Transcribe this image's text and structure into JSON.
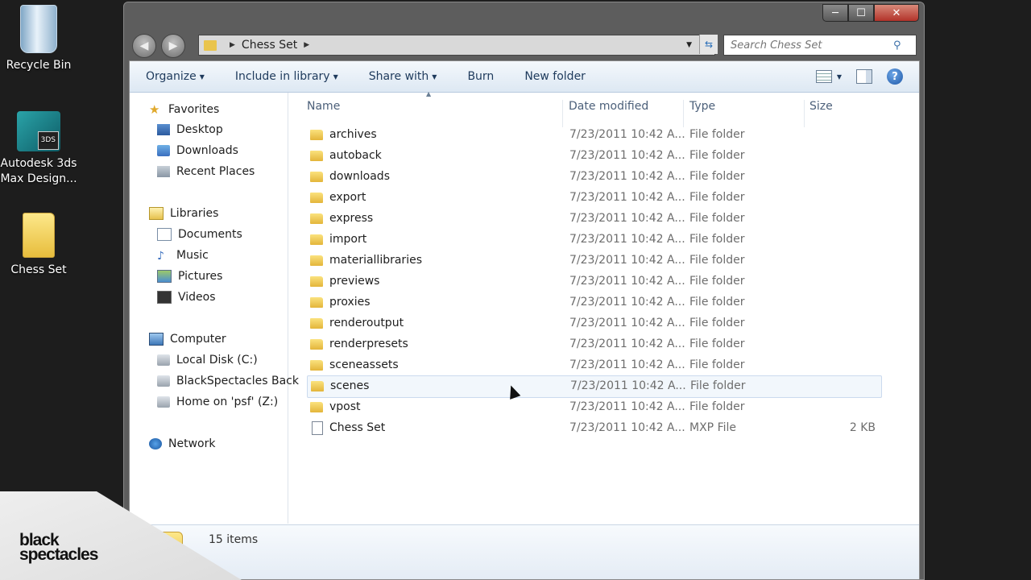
{
  "desktop": {
    "icons": [
      {
        "label_line1": "Recycle Bin",
        "label_line2": "",
        "icon": "recycle-bin-icon"
      },
      {
        "label_line1": "Autodesk 3ds",
        "label_line2": "Max Design...",
        "icon": "autodesk-3ds-max-icon",
        "badge": "3DS"
      },
      {
        "label_line1": "Chess Set",
        "label_line2": "",
        "icon": "folder-icon"
      }
    ]
  },
  "window": {
    "caption": {
      "minimize": "─",
      "maximize": "☐",
      "close": "✕"
    },
    "address": {
      "segment": "Chess Set"
    },
    "search": {
      "placeholder": "Search Chess Set"
    }
  },
  "toolbar": {
    "organize": "Organize",
    "include_in_library": "Include in library",
    "share_with": "Share with",
    "burn": "Burn",
    "new_folder": "New folder"
  },
  "nav": {
    "favorites": "Favorites",
    "desktop": "Desktop",
    "downloads": "Downloads",
    "recent_places": "Recent Places",
    "libraries": "Libraries",
    "documents": "Documents",
    "music": "Music",
    "pictures": "Pictures",
    "videos": "Videos",
    "computer": "Computer",
    "local_disk": "Local Disk (C:)",
    "blackspectacles": "BlackSpectacles Back",
    "home_psf": "Home on 'psf' (Z:)",
    "network": "Network"
  },
  "columns": {
    "name": "Name",
    "date": "Date modified",
    "type": "Type",
    "size": "Size"
  },
  "files": [
    {
      "name": "archives",
      "date": "7/23/2011 10:42 A...",
      "type": "File folder",
      "size": ""
    },
    {
      "name": "autoback",
      "date": "7/23/2011 10:42 A...",
      "type": "File folder",
      "size": ""
    },
    {
      "name": "downloads",
      "date": "7/23/2011 10:42 A...",
      "type": "File folder",
      "size": ""
    },
    {
      "name": "export",
      "date": "7/23/2011 10:42 A...",
      "type": "File folder",
      "size": ""
    },
    {
      "name": "express",
      "date": "7/23/2011 10:42 A...",
      "type": "File folder",
      "size": ""
    },
    {
      "name": "import",
      "date": "7/23/2011 10:42 A...",
      "type": "File folder",
      "size": ""
    },
    {
      "name": "materiallibraries",
      "date": "7/23/2011 10:42 A...",
      "type": "File folder",
      "size": ""
    },
    {
      "name": "previews",
      "date": "7/23/2011 10:42 A...",
      "type": "File folder",
      "size": ""
    },
    {
      "name": "proxies",
      "date": "7/23/2011 10:42 A...",
      "type": "File folder",
      "size": ""
    },
    {
      "name": "renderoutput",
      "date": "7/23/2011 10:42 A...",
      "type": "File folder",
      "size": ""
    },
    {
      "name": "renderpresets",
      "date": "7/23/2011 10:42 A...",
      "type": "File folder",
      "size": ""
    },
    {
      "name": "sceneassets",
      "date": "7/23/2011 10:42 A...",
      "type": "File folder",
      "size": ""
    },
    {
      "name": "scenes",
      "date": "7/23/2011 10:42 A...",
      "type": "File folder",
      "size": ""
    },
    {
      "name": "vpost",
      "date": "7/23/2011 10:42 A...",
      "type": "File folder",
      "size": ""
    },
    {
      "name": "Chess Set",
      "date": "7/23/2011 10:42 A...",
      "type": "MXP File",
      "size": "2 KB"
    }
  ],
  "details": {
    "count": "15 items"
  },
  "brand": {
    "line1": "black",
    "line2": "spectacles"
  }
}
